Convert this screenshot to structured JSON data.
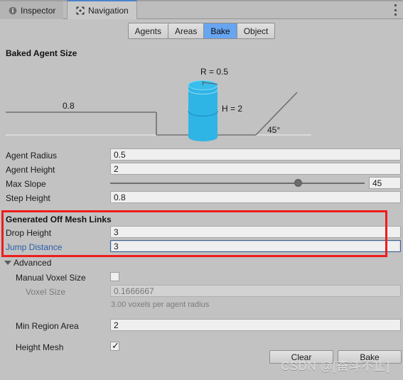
{
  "window": {
    "tabs": [
      {
        "label": "Inspector",
        "icon": "info-icon",
        "active": false
      },
      {
        "label": "Navigation",
        "icon": "move-arrows-icon",
        "active": true
      }
    ],
    "menu_icon": "kebab-menu-icon"
  },
  "toolbar": {
    "buttons": [
      {
        "label": "Agents",
        "selected": false
      },
      {
        "label": "Areas",
        "selected": false
      },
      {
        "label": "Bake",
        "selected": true
      },
      {
        "label": "Object",
        "selected": false
      }
    ],
    "accent_color": "#67a5f0"
  },
  "baked_agent_size": {
    "heading": "Baked Agent Size",
    "diagram": {
      "radius_label": "R = 0.5",
      "height_label": "H = 2",
      "step_label": "0.8",
      "slope_label": "45°",
      "agent_color": "#29ABE2"
    },
    "fields": [
      {
        "label": "Agent Radius",
        "value": "0.5",
        "type": "text"
      },
      {
        "label": "Agent Height",
        "value": "2",
        "type": "text"
      },
      {
        "label": "Max Slope",
        "value": "45",
        "type": "slider",
        "slider_min": 0,
        "slider_max": 60,
        "slider_value": 45
      },
      {
        "label": "Step Height",
        "value": "0.8",
        "type": "text"
      }
    ]
  },
  "generated_off_mesh_links": {
    "heading": "Generated Off Mesh Links",
    "highlight_color": "#ef1c1c",
    "fields": [
      {
        "label": "Drop Height",
        "value": "3",
        "label_color": "normal",
        "focused": false
      },
      {
        "label": "Jump Distance",
        "value": "3",
        "label_color": "blue",
        "focused": true
      }
    ]
  },
  "advanced": {
    "heading": "Advanced",
    "expanded": true,
    "manual_voxel_size": {
      "label": "Manual Voxel Size",
      "checked": false
    },
    "voxel_size": {
      "label": "Voxel Size",
      "value": "0.1666667",
      "readonly": true
    },
    "note": "3.00 voxels per agent radius",
    "min_region_area": {
      "label": "Min Region Area",
      "value": "2"
    },
    "height_mesh": {
      "label": "Height Mesh",
      "checked": true
    }
  },
  "actions": {
    "clear_label": "Clear",
    "bake_label": "Bake"
  },
  "watermark": {
    "text": "CSDN @[奋斗不止]"
  }
}
